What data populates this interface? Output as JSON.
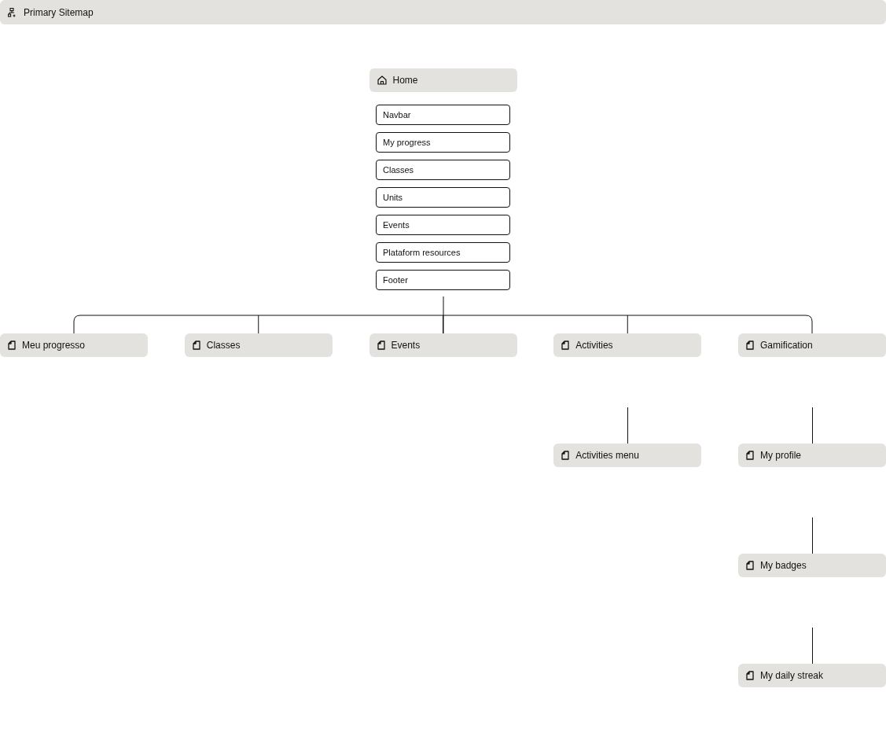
{
  "header": {
    "title": "Primary Sitemap"
  },
  "home": {
    "label": "Home",
    "sections": [
      "Navbar",
      "My progress",
      "Classes",
      "Units",
      "Events",
      "Plataform resources",
      "Footer"
    ]
  },
  "pages": [
    {
      "label": "Meu progresso"
    },
    {
      "label": "Classes"
    },
    {
      "label": "Events"
    },
    {
      "label": "Activities",
      "children": [
        {
          "label": "Activities menu"
        }
      ]
    },
    {
      "label": "Gamification",
      "children": [
        {
          "label": "My profile"
        },
        {
          "label": "My badges"
        },
        {
          "label": "My daily streak"
        }
      ]
    }
  ]
}
